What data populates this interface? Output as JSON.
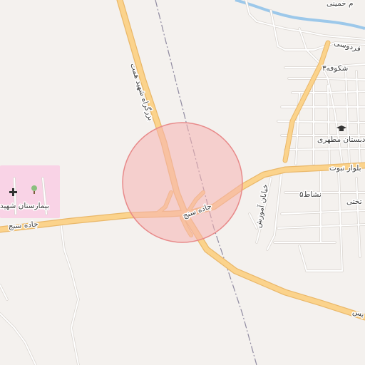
{
  "map": {
    "colors": {
      "background": "#f4f1ee",
      "major_road": "#fbd38c",
      "major_road_casing": "#eab86a",
      "minor_road": "#ffffff",
      "minor_road_casing": "#d9d4cf",
      "railway": "#8f8aa0",
      "hospital_area": "#f9d3e6",
      "river": "#9cc8ea",
      "highlight_circle_fill": "#f6b3b3",
      "highlight_circle_stroke": "#e88a8a"
    },
    "labels": {
      "boulevard_shahid_hemmat": "بزرگراه شهید همت",
      "jadeh_sanandaj_left": "جاده سنج",
      "jadeh_sanandaj_center": "جاده سنج",
      "hospital": "بیمارستان شهید",
      "school": "دبستان مطهری",
      "ferdowsi": "فردوسی",
      "shokoufeh3": "شکوفه۳",
      "boulevard_noot": "بلوار نبوت",
      "nashat5": "نشاط۵",
      "motahhari_top": "م خمینی",
      "amuzesh_street": "خیابان آموزش",
      "road_bottom_right": "بس",
      "east_right": "تختی"
    },
    "icons": {
      "hospital": "hospital-cross-icon",
      "school": "graduation-cap-icon"
    }
  }
}
